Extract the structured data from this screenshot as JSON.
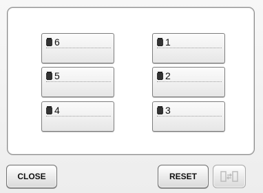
{
  "spools": {
    "left": [
      {
        "number": "6",
        "icon": "thread-spool-icon"
      },
      {
        "number": "5",
        "icon": "thread-spool-icon"
      },
      {
        "number": "4",
        "icon": "thread-spool-icon"
      }
    ],
    "right": [
      {
        "number": "1",
        "icon": "thread-spool-icon"
      },
      {
        "number": "2",
        "icon": "thread-spool-icon"
      },
      {
        "number": "3",
        "icon": "thread-spool-icon"
      }
    ]
  },
  "footer": {
    "close_label": "CLOSE",
    "reset_label": "RESET",
    "swap_icon": "spool-swap-icon",
    "swap_enabled": false
  }
}
